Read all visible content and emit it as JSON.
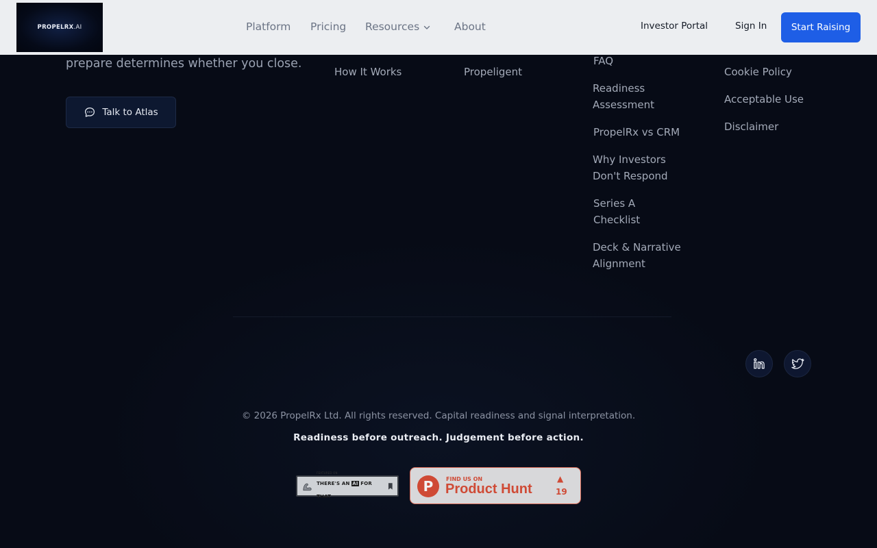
{
  "header": {
    "logo_text": "PROPELRX",
    "logo_suffix": ".AI",
    "nav": {
      "platform": "Platform",
      "pricing": "Pricing",
      "resources": "Resources",
      "about": "About"
    },
    "investor_portal": "Investor Portal",
    "sign_in": "Sign In",
    "start_raising": "Start Raising"
  },
  "brand": {
    "tagline": "prepare determines whether you close.",
    "talk_button": "Talk to Atlas"
  },
  "footer_columns": {
    "col1": [
      "How It Works"
    ],
    "col2": [
      "Propeligent"
    ],
    "col3": [
      "FAQ",
      "Readiness",
      "Assessment",
      "PropelRx vs CRM",
      "Why Investors",
      "Don't Respond",
      "Series A",
      "Checklist",
      "Deck & Narrative",
      "Alignment"
    ],
    "col4": [
      "Cookie Policy",
      "Acceptable Use",
      "Disclaimer"
    ]
  },
  "social": {
    "linkedin": "linkedin-icon",
    "twitter": "twitter-icon"
  },
  "copyright": "© 2026 PropelRx Ltd. All rights reserved. Capital readiness and signal interpretation.",
  "motto": "Readiness before outreach. Judgement before action.",
  "badges": {
    "taaft_small": "FEATURED ON",
    "taaft_pre": "THERE'S AN ",
    "taaft_ai": "AI",
    "taaft_post": " FOR THAT",
    "ph_small": "FIND US ON",
    "ph_big": "Product Hunt",
    "ph_letter": "P",
    "ph_upvote": "▲",
    "ph_count": "19"
  },
  "colors": {
    "accent": "#1e5ee6",
    "background": "#070b16",
    "header_bg": "#eceef1",
    "product_hunt": "#cf4a35"
  }
}
